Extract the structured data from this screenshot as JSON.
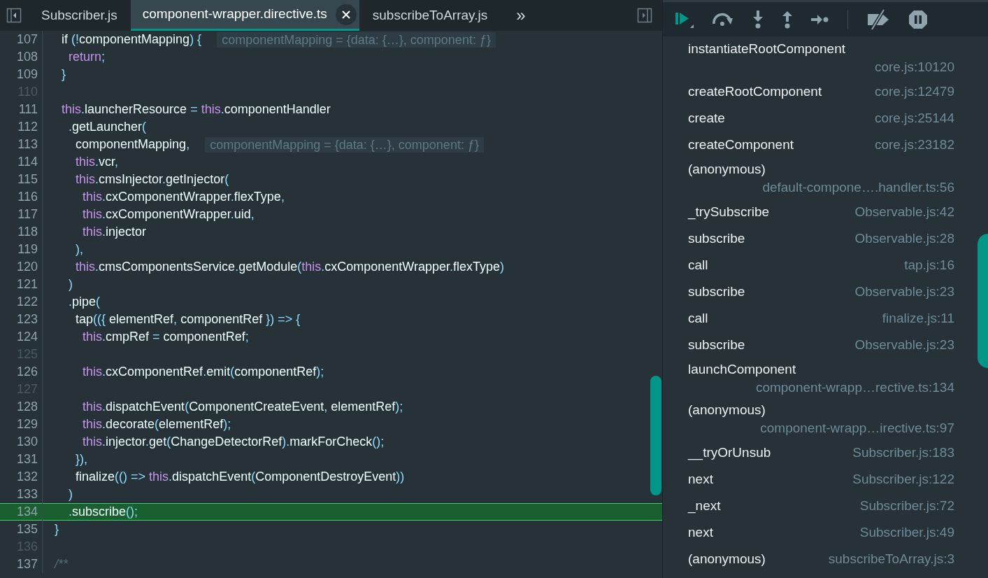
{
  "tabs": [
    {
      "label": "Subscriber.js",
      "selected": false
    },
    {
      "label": "component-wrapper.directive.ts",
      "selected": true
    },
    {
      "label": "subscribeToArray.js",
      "selected": false
    }
  ],
  "overflow_button": "»",
  "code_lines": [
    {
      "number": "107",
      "tokens": [
        {
          "text": "    if ",
          "kind": "plain"
        },
        {
          "text": "(!",
          "kind": "punct"
        },
        {
          "text": "componentMapping",
          "kind": "plain"
        },
        {
          "text": ") {",
          "kind": "punct"
        }
      ],
      "hint": "componentMapping = {data: {…}, component: ƒ}",
      "current": false
    },
    {
      "number": "108",
      "tokens": [
        {
          "text": "      return",
          "kind": "keyword"
        },
        {
          "text": ";",
          "kind": "punct"
        }
      ],
      "current": false
    },
    {
      "number": "109",
      "tokens": [
        {
          "text": "    }",
          "kind": "punct"
        }
      ],
      "current": false
    },
    {
      "number": "110",
      "current": false
    },
    {
      "number": "111",
      "tokens": [
        {
          "text": "    this",
          "kind": "keyword"
        },
        {
          "text": ".",
          "kind": "punct"
        },
        {
          "text": "launcherResource ",
          "kind": "plain"
        },
        {
          "text": "= ",
          "kind": "punct"
        },
        {
          "text": "this",
          "kind": "keyword"
        },
        {
          "text": ".",
          "kind": "punct"
        },
        {
          "text": "componentHandler",
          "kind": "plain"
        }
      ],
      "current": false
    },
    {
      "number": "112",
      "tokens": [
        {
          "text": "      .",
          "kind": "punct"
        },
        {
          "text": "getLauncher",
          "kind": "plain"
        },
        {
          "text": "(",
          "kind": "punct"
        }
      ],
      "current": false
    },
    {
      "number": "113",
      "tokens": [
        {
          "text": "        componentMapping",
          "kind": "plain"
        },
        {
          "text": ",",
          "kind": "punct"
        }
      ],
      "hint": "componentMapping = {data: {…}, component: ƒ}",
      "current": false
    },
    {
      "number": "114",
      "tokens": [
        {
          "text": "        this",
          "kind": "keyword"
        },
        {
          "text": ".",
          "kind": "punct"
        },
        {
          "text": "vcr",
          "kind": "plain"
        },
        {
          "text": ",",
          "kind": "punct"
        }
      ],
      "current": false
    },
    {
      "number": "115",
      "tokens": [
        {
          "text": "        this",
          "kind": "keyword"
        },
        {
          "text": ".",
          "kind": "punct"
        },
        {
          "text": "cmsInjector",
          "kind": "plain"
        },
        {
          "text": ".",
          "kind": "punct"
        },
        {
          "text": "getInjector",
          "kind": "plain"
        },
        {
          "text": "(",
          "kind": "punct"
        }
      ],
      "current": false
    },
    {
      "number": "116",
      "tokens": [
        {
          "text": "          this",
          "kind": "keyword"
        },
        {
          "text": ".",
          "kind": "punct"
        },
        {
          "text": "cxComponentWrapper",
          "kind": "plain"
        },
        {
          "text": ".",
          "kind": "punct"
        },
        {
          "text": "flexType",
          "kind": "plain"
        },
        {
          "text": ",",
          "kind": "punct"
        }
      ],
      "current": false
    },
    {
      "number": "117",
      "tokens": [
        {
          "text": "          this",
          "kind": "keyword"
        },
        {
          "text": ".",
          "kind": "punct"
        },
        {
          "text": "cxComponentWrapper",
          "kind": "plain"
        },
        {
          "text": ".",
          "kind": "punct"
        },
        {
          "text": "uid",
          "kind": "plain"
        },
        {
          "text": ",",
          "kind": "punct"
        }
      ],
      "current": false
    },
    {
      "number": "118",
      "tokens": [
        {
          "text": "          this",
          "kind": "keyword"
        },
        {
          "text": ".",
          "kind": "punct"
        },
        {
          "text": "injector",
          "kind": "plain"
        }
      ],
      "current": false
    },
    {
      "number": "119",
      "tokens": [
        {
          "text": "        ),",
          "kind": "punct"
        }
      ],
      "current": false
    },
    {
      "number": "120",
      "tokens": [
        {
          "text": "        this",
          "kind": "keyword"
        },
        {
          "text": ".",
          "kind": "punct"
        },
        {
          "text": "cmsComponentsService",
          "kind": "plain"
        },
        {
          "text": ".",
          "kind": "punct"
        },
        {
          "text": "getModule",
          "kind": "plain"
        },
        {
          "text": "(",
          "kind": "punct"
        },
        {
          "text": "this",
          "kind": "keyword"
        },
        {
          "text": ".",
          "kind": "punct"
        },
        {
          "text": "cxComponentWrapper",
          "kind": "plain"
        },
        {
          "text": ".",
          "kind": "punct"
        },
        {
          "text": "flexType",
          "kind": "plain"
        },
        {
          "text": ")",
          "kind": "punct"
        }
      ],
      "current": false
    },
    {
      "number": "121",
      "tokens": [
        {
          "text": "      )",
          "kind": "punct"
        }
      ],
      "current": false
    },
    {
      "number": "122",
      "tokens": [
        {
          "text": "      .",
          "kind": "punct"
        },
        {
          "text": "pipe",
          "kind": "plain"
        },
        {
          "text": "(",
          "kind": "punct"
        }
      ],
      "current": false
    },
    {
      "number": "123",
      "tokens": [
        {
          "text": "        tap",
          "kind": "plain"
        },
        {
          "text": "(({ ",
          "kind": "punct"
        },
        {
          "text": "elementRef",
          "kind": "plain"
        },
        {
          "text": ", ",
          "kind": "punct"
        },
        {
          "text": "componentRef ",
          "kind": "plain"
        },
        {
          "text": "}) => {",
          "kind": "punct"
        }
      ],
      "current": false
    },
    {
      "number": "124",
      "tokens": [
        {
          "text": "          this",
          "kind": "keyword"
        },
        {
          "text": ".",
          "kind": "punct"
        },
        {
          "text": "cmpRef ",
          "kind": "plain"
        },
        {
          "text": "= ",
          "kind": "punct"
        },
        {
          "text": "componentRef",
          "kind": "plain"
        },
        {
          "text": ";",
          "kind": "punct"
        }
      ],
      "current": false
    },
    {
      "number": "125",
      "current": false
    },
    {
      "number": "126",
      "tokens": [
        {
          "text": "          this",
          "kind": "keyword"
        },
        {
          "text": ".",
          "kind": "punct"
        },
        {
          "text": "cxComponentRef",
          "kind": "plain"
        },
        {
          "text": ".",
          "kind": "punct"
        },
        {
          "text": "emit",
          "kind": "plain"
        },
        {
          "text": "(",
          "kind": "punct"
        },
        {
          "text": "componentRef",
          "kind": "plain"
        },
        {
          "text": ");",
          "kind": "punct"
        }
      ],
      "current": false
    },
    {
      "number": "127",
      "current": false
    },
    {
      "number": "128",
      "tokens": [
        {
          "text": "          this",
          "kind": "keyword"
        },
        {
          "text": ".",
          "kind": "punct"
        },
        {
          "text": "dispatchEvent",
          "kind": "plain"
        },
        {
          "text": "(",
          "kind": "punct"
        },
        {
          "text": "ComponentCreateEvent",
          "kind": "plain"
        },
        {
          "text": ", ",
          "kind": "punct"
        },
        {
          "text": "elementRef",
          "kind": "plain"
        },
        {
          "text": ");",
          "kind": "punct"
        }
      ],
      "current": false
    },
    {
      "number": "129",
      "tokens": [
        {
          "text": "          this",
          "kind": "keyword"
        },
        {
          "text": ".",
          "kind": "punct"
        },
        {
          "text": "decorate",
          "kind": "plain"
        },
        {
          "text": "(",
          "kind": "punct"
        },
        {
          "text": "elementRef",
          "kind": "plain"
        },
        {
          "text": ");",
          "kind": "punct"
        }
      ],
      "current": false
    },
    {
      "number": "130",
      "tokens": [
        {
          "text": "          this",
          "kind": "keyword"
        },
        {
          "text": ".",
          "kind": "punct"
        },
        {
          "text": "injector",
          "kind": "plain"
        },
        {
          "text": ".",
          "kind": "punct"
        },
        {
          "text": "get",
          "kind": "plain"
        },
        {
          "text": "(",
          "kind": "punct"
        },
        {
          "text": "ChangeDetectorRef",
          "kind": "plain"
        },
        {
          "text": ").",
          "kind": "punct"
        },
        {
          "text": "markForCheck",
          "kind": "plain"
        },
        {
          "text": "();",
          "kind": "punct"
        }
      ],
      "current": false
    },
    {
      "number": "131",
      "tokens": [
        {
          "text": "        }),",
          "kind": "punct"
        }
      ],
      "current": false
    },
    {
      "number": "132",
      "tokens": [
        {
          "text": "        finalize",
          "kind": "plain"
        },
        {
          "text": "(() => ",
          "kind": "punct"
        },
        {
          "text": "this",
          "kind": "keyword"
        },
        {
          "text": ".",
          "kind": "punct"
        },
        {
          "text": "dispatchEvent",
          "kind": "plain"
        },
        {
          "text": "(",
          "kind": "punct"
        },
        {
          "text": "ComponentDestroyEvent",
          "kind": "plain"
        },
        {
          "text": "))",
          "kind": "punct"
        }
      ],
      "current": false
    },
    {
      "number": "133",
      "tokens": [
        {
          "text": "      )",
          "kind": "punct"
        }
      ],
      "current": false
    },
    {
      "number": "134",
      "tokens": [
        {
          "text": "      .",
          "kind": "punct"
        },
        {
          "text": "subscribe",
          "kind": "plain"
        },
        {
          "text": "();",
          "kind": "punct"
        }
      ],
      "current": true
    },
    {
      "number": "135",
      "tokens": [
        {
          "text": "  }",
          "kind": "punct"
        }
      ],
      "current": false
    },
    {
      "number": "136",
      "current": false
    },
    {
      "number": "137",
      "tokens": [
        {
          "text": "  /**",
          "kind": "comment"
        }
      ],
      "current": false
    }
  ],
  "call_stack": [
    {
      "name": "instantiateRootComponent",
      "location": "core.js:10120",
      "kind": "two-line"
    },
    {
      "name": "createRootComponent",
      "location": "core.js:12479",
      "kind": "one-line"
    },
    {
      "name": "create",
      "location": "core.js:25144",
      "kind": "one-line"
    },
    {
      "name": "createComponent",
      "location": "core.js:23182",
      "kind": "one-line"
    },
    {
      "name": "(anonymous)",
      "location": "default-compone….handler.ts:56",
      "kind": "two-line"
    },
    {
      "name": "_trySubscribe",
      "location": "Observable.js:42",
      "kind": "one-line"
    },
    {
      "name": "subscribe",
      "location": "Observable.js:28",
      "kind": "one-line"
    },
    {
      "name": "call",
      "location": "tap.js:16",
      "kind": "one-line"
    },
    {
      "name": "subscribe",
      "location": "Observable.js:23",
      "kind": "one-line"
    },
    {
      "name": "call",
      "location": "finalize.js:11",
      "kind": "one-line"
    },
    {
      "name": "subscribe",
      "location": "Observable.js:23",
      "kind": "one-line"
    },
    {
      "name": "launchComponent",
      "location": "component-wrapp…rective.ts:134",
      "kind": "two-line"
    },
    {
      "name": "(anonymous)",
      "location": "component-wrapp…irective.ts:97",
      "kind": "two-line"
    },
    {
      "name": "__tryOrUnsub",
      "location": "Subscriber.js:183",
      "kind": "one-line"
    },
    {
      "name": "next",
      "location": "Subscriber.js:122",
      "kind": "one-line"
    },
    {
      "name": "_next",
      "location": "Subscriber.js:72",
      "kind": "one-line"
    },
    {
      "name": "next",
      "location": "Subscriber.js:49",
      "kind": "one-line"
    },
    {
      "name": "(anonymous)",
      "location": "subscribeToArray.js:3",
      "kind": "one-line"
    }
  ]
}
